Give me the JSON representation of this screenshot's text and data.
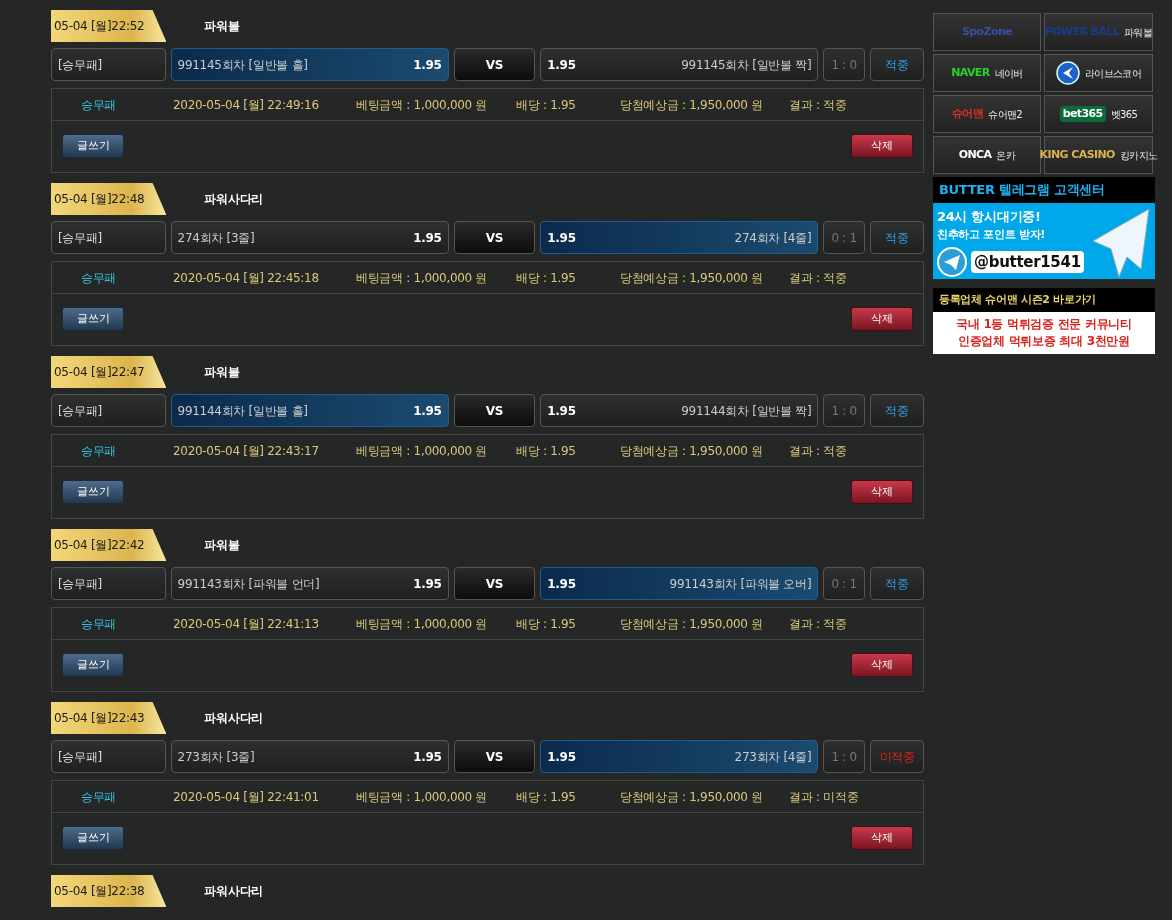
{
  "bets": [
    {
      "time": "05-04 [월]22:52",
      "game": "파워볼",
      "bet_type": "[승무패]",
      "home": {
        "label": "991145회차 [일반볼 홀]",
        "odds": "1.95",
        "selected": true
      },
      "vs": "VS",
      "away": {
        "label": "991145회차 [일반볼 짝]",
        "odds": "1.95",
        "selected": false
      },
      "score": "1 : 0",
      "result": "적중",
      "hit": true,
      "info": {
        "type": "승무패",
        "datetime": "2020-05-04 [월] 22:49:16",
        "amount": "베팅금액 : 1,000,000 원",
        "odds": "배당 : 1.95",
        "payout": "당첨예상금 : 1,950,000 원",
        "result": "결과 : 적중"
      },
      "write_button": "글쓰기",
      "delete_button": "삭제"
    },
    {
      "time": "05-04 [월]22:48",
      "game": "파워사다리",
      "bet_type": "[승무패]",
      "home": {
        "label": "274회차 [3줄]",
        "odds": "1.95",
        "selected": false
      },
      "vs": "VS",
      "away": {
        "label": "274회차 [4줄]",
        "odds": "1.95",
        "selected": true
      },
      "score": "0 : 1",
      "result": "적중",
      "hit": true,
      "info": {
        "type": "승무패",
        "datetime": "2020-05-04 [월] 22:45:18",
        "amount": "베팅금액 : 1,000,000 원",
        "odds": "배당 : 1.95",
        "payout": "당첨예상금 : 1,950,000 원",
        "result": "결과 : 적중"
      },
      "write_button": "글쓰기",
      "delete_button": "삭제"
    },
    {
      "time": "05-04 [월]22:47",
      "game": "파워볼",
      "bet_type": "[승무패]",
      "home": {
        "label": "991144회차 [일반볼 홀]",
        "odds": "1.95",
        "selected": true
      },
      "vs": "VS",
      "away": {
        "label": "991144회차 [일반볼 짝]",
        "odds": "1.95",
        "selected": false
      },
      "score": "1 : 0",
      "result": "적중",
      "hit": true,
      "info": {
        "type": "승무패",
        "datetime": "2020-05-04 [월] 22:43:17",
        "amount": "베팅금액 : 1,000,000 원",
        "odds": "배당 : 1.95",
        "payout": "당첨예상금 : 1,950,000 원",
        "result": "결과 : 적중"
      },
      "write_button": "글쓰기",
      "delete_button": "삭제"
    },
    {
      "time": "05-04 [월]22:42",
      "game": "파워볼",
      "bet_type": "[승무패]",
      "home": {
        "label": "991143회차 [파워볼 언더]",
        "odds": "1.95",
        "selected": false
      },
      "vs": "VS",
      "away": {
        "label": "991143회차 [파워볼 오버]",
        "odds": "1.95",
        "selected": true
      },
      "score": "0 : 1",
      "result": "적중",
      "hit": true,
      "info": {
        "type": "승무패",
        "datetime": "2020-05-04 [월] 22:41:13",
        "amount": "베팅금액 : 1,000,000 원",
        "odds": "배당 : 1.95",
        "payout": "당첨예상금 : 1,950,000 원",
        "result": "결과 : 적중"
      },
      "write_button": "글쓰기",
      "delete_button": "삭제"
    },
    {
      "time": "05-04 [월]22:43",
      "game": "파워사다리",
      "bet_type": "[승무패]",
      "home": {
        "label": "273회차 [3줄]",
        "odds": "1.95",
        "selected": false
      },
      "vs": "VS",
      "away": {
        "label": "273회차 [4줄]",
        "odds": "1.95",
        "selected": true
      },
      "score": "1 : 0",
      "result": "미적중",
      "hit": false,
      "info": {
        "type": "승무패",
        "datetime": "2020-05-04 [월] 22:41:01",
        "amount": "베팅금액 : 1,000,000 원",
        "odds": "배당 : 1.95",
        "payout": "당첨예상금 : 1,950,000 원",
        "result": "결과 : 미적중"
      },
      "write_button": "글쓰기",
      "delete_button": "삭제"
    },
    {
      "time": "05-04 [월]22:38",
      "game": "파워사다리"
    }
  ],
  "sidebar": {
    "links": [
      {
        "logo": "SpoZone"
      },
      {
        "logo": "POWER BALL",
        "label": "파워볼"
      },
      {
        "logo": "NAVER",
        "label": "네이버"
      },
      {
        "label": "라이브스코어"
      },
      {
        "logo": "슈어맨",
        "label": "슈어맨2"
      },
      {
        "logo": "bet365",
        "label": "벳365"
      },
      {
        "logo": "ONCA",
        "label": "온카"
      },
      {
        "logo": "KING CASINO",
        "label": "킹카지노"
      }
    ],
    "telegram_banner": {
      "title": "BUTTER 텔레그램 고객센터",
      "line_1": "24시 항시대기중!",
      "line_2": "친추하고 포인트 받자!",
      "handle": "@butter1541"
    },
    "partner_banner": {
      "title": "등록업체 **슈어맨 시즌2** 바로가기",
      "line_1": "국내 1등 먹튀검증 전문 커뮤니티",
      "line_2": "인증업체 먹튀보증 최대 3천만원"
    }
  }
}
